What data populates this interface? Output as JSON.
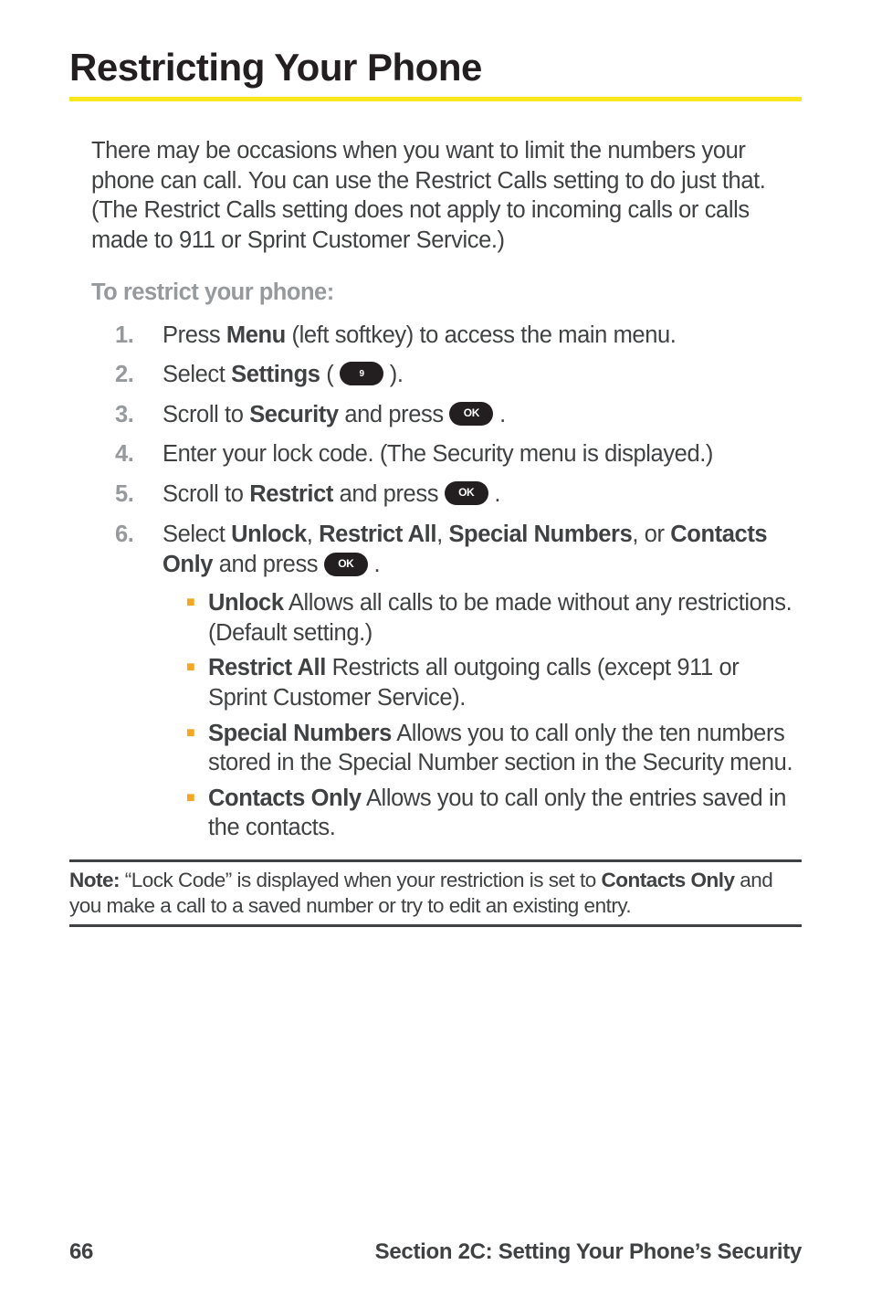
{
  "title": "Restricting Your Phone",
  "intro": "There may be occasions when you want to limit the numbers your phone can call. You can use the Restrict Calls setting to do just that. (The Restrict Calls setting does not apply to incoming calls or calls made to 911 or Sprint Customer Service.)",
  "subhead": "To restrict your phone:",
  "steps": {
    "s1": {
      "num": "1.",
      "t1": "Press ",
      "b1": "Menu",
      "t2": " (left softkey) to access the main menu."
    },
    "s2": {
      "num": "2.",
      "t1": "Select ",
      "b1": "Settings",
      "t2": " ( ",
      "key": "9",
      "t3": " )."
    },
    "s3": {
      "num": "3.",
      "t1": "Scroll to ",
      "b1": "Security",
      "t2": " and press ",
      "key": "OK",
      "t3": " ."
    },
    "s4": {
      "num": "4.",
      "t1": "Enter your lock code. (The Security menu is displayed.)"
    },
    "s5": {
      "num": "5.",
      "t1": "Scroll to ",
      "b1": "Restrict",
      "t2": " and press ",
      "key": "OK",
      "t3": " ."
    },
    "s6": {
      "num": "6.",
      "t1": "Select ",
      "b1": "Unlock",
      "c1": ", ",
      "b2": "Restrict All",
      "c2": ", ",
      "b3": "Special Numbers",
      "c3": ", or ",
      "b4": "Contacts Only",
      "t2": " and press ",
      "key": "OK",
      "t3": " ."
    }
  },
  "bullets": {
    "b1": {
      "label": "Unlock",
      "text": " Allows all calls to be made without any restrictions. (Default setting.)"
    },
    "b2": {
      "label": "Restrict All",
      "text": " Restricts all outgoing calls (except 911 or Sprint Customer Service)."
    },
    "b3": {
      "label": "Special Numbers",
      "text": " Allows you to call only the ten numbers stored in the Special Number section in the Security menu."
    },
    "b4": {
      "label": "Contacts Only",
      "text": " Allows you to call only the entries saved in the contacts."
    }
  },
  "note": {
    "label": "Note: ",
    "t1": "“Lock Code” is displayed when your restriction is set to ",
    "b1": "Contacts Only",
    "t2": " and you make a call to a saved number or try to edit an existing entry."
  },
  "footer": {
    "page": "66",
    "section": "Section 2C: Setting Your Phone’s Security"
  },
  "bullet_mark": "■"
}
